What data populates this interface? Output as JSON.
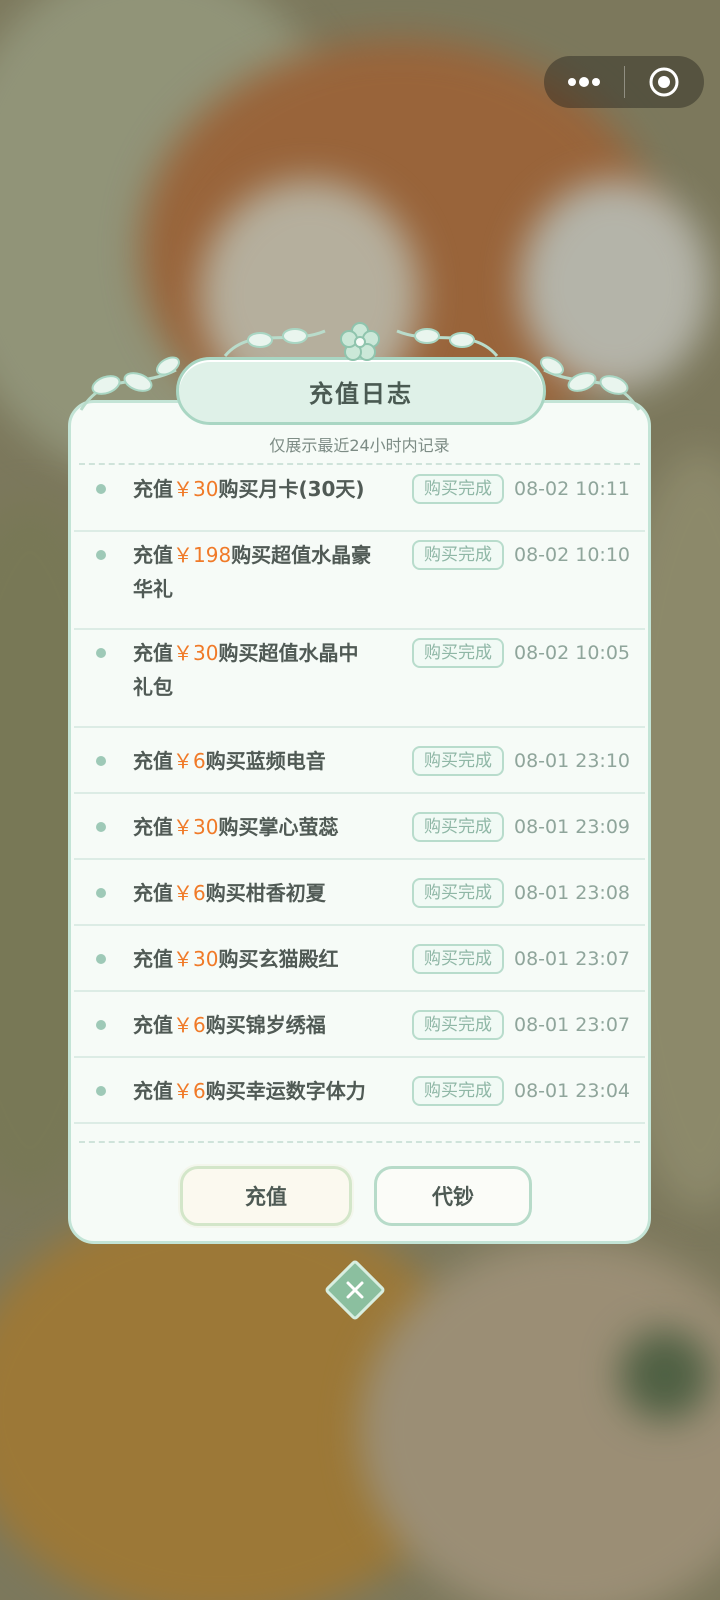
{
  "capsule": {
    "more_icon": "more-dots-icon",
    "close_icon": "target-circle-icon"
  },
  "dialog": {
    "title": "充值日志",
    "subtitle": "仅展示最近24小时内记录",
    "status_label": "购买完成",
    "entries": [
      {
        "prefix": "充值",
        "price": "￥30",
        "line1": "购买月卡(30天)",
        "line2": "",
        "time": "08-02 10:11"
      },
      {
        "prefix": "充值",
        "price": "￥198",
        "line1": "购买超值水晶豪",
        "line2": "华礼",
        "time": "08-02 10:10"
      },
      {
        "prefix": "充值",
        "price": "￥30",
        "line1": "购买超值水晶中",
        "line2": "礼包",
        "time": "08-02 10:05"
      },
      {
        "prefix": "充值",
        "price": "￥6",
        "line1": "购买蓝频电音",
        "line2": "",
        "time": "08-01 23:10"
      },
      {
        "prefix": "充值",
        "price": "￥30",
        "line1": "购买掌心萤蕊",
        "line2": "",
        "time": "08-01 23:09"
      },
      {
        "prefix": "充值",
        "price": "￥6",
        "line1": "购买柑香初夏",
        "line2": "",
        "time": "08-01 23:08"
      },
      {
        "prefix": "充值",
        "price": "￥30",
        "line1": "购买玄猫殿红",
        "line2": "",
        "time": "08-01 23:07"
      },
      {
        "prefix": "充值",
        "price": "￥6",
        "line1": "购买锦岁绣福",
        "line2": "",
        "time": "08-01 23:07"
      },
      {
        "prefix": "充值",
        "price": "￥6",
        "line1": "购买幸运数字体力",
        "line2": "",
        "time": "08-01 23:04"
      }
    ],
    "buttons": {
      "recharge": "充值",
      "daichao": "代钞"
    },
    "close_icon": "close-icon"
  },
  "colors": {
    "price": "#f07a28",
    "accent": "#a9d6c3",
    "panel": "#f6fbf7"
  }
}
